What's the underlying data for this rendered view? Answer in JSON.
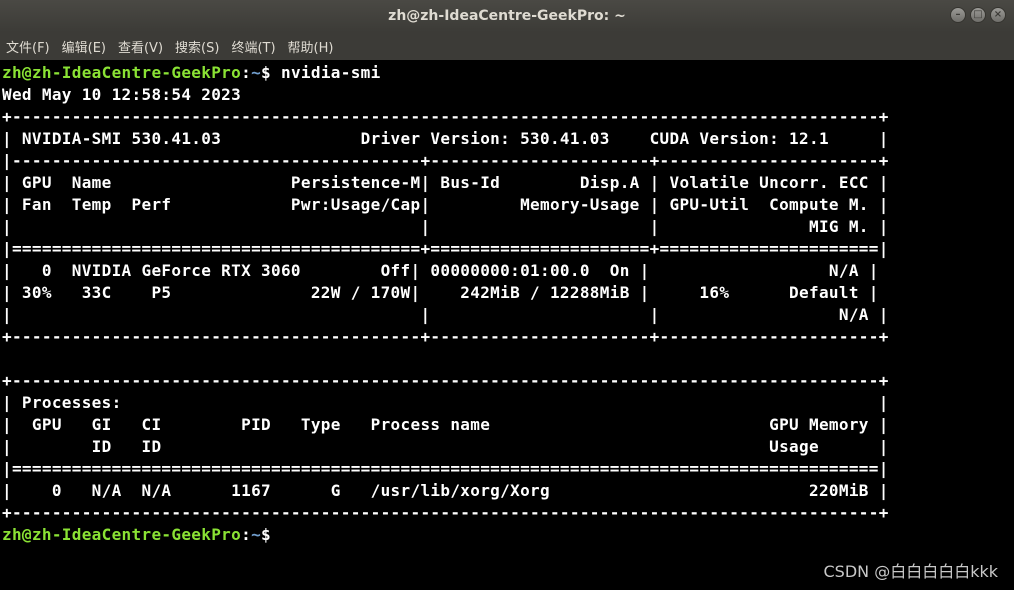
{
  "window": {
    "title": "zh@zh-IdeaCentre-GeekPro: ~",
    "controls": {
      "minimize": "–",
      "maximize": "□",
      "close": "×"
    }
  },
  "menu": {
    "items": [
      "文件(F)",
      "编辑(E)",
      "查看(V)",
      "搜索(S)",
      "终端(T)",
      "帮助(H)"
    ]
  },
  "terminal": {
    "prompt_user": "zh@zh-IdeaCentre-GeekPro",
    "prompt_path": "~",
    "prompt_sep": ":",
    "prompt_symbol": "$",
    "command": " nvidia-smi",
    "output_lines": [
      "Wed May 10 12:58:54 2023",
      "+---------------------------------------------------------------------------------------+",
      "| NVIDIA-SMI 530.41.03              Driver Version: 530.41.03    CUDA Version: 12.1     |",
      "|-----------------------------------------+----------------------+----------------------+",
      "| GPU  Name                  Persistence-M| Bus-Id        Disp.A | Volatile Uncorr. ECC |",
      "| Fan  Temp  Perf            Pwr:Usage/Cap|         Memory-Usage | GPU-Util  Compute M. |",
      "|                                         |                      |               MIG M. |",
      "|=========================================+======================+======================|",
      "|   0  NVIDIA GeForce RTX 3060        Off| 00000000:01:00.0  On |                  N/A |",
      "| 30%   33C    P5              22W / 170W|    242MiB / 12288MiB |     16%      Default |",
      "|                                         |                      |                  N/A |",
      "+-----------------------------------------+----------------------+----------------------+",
      "",
      "+---------------------------------------------------------------------------------------+",
      "| Processes:                                                                            |",
      "|  GPU   GI   CI        PID   Type   Process name                            GPU Memory |",
      "|        ID   ID                                                             Usage      |",
      "|=======================================================================================|",
      "|    0   N/A  N/A      1167      G   /usr/lib/xorg/Xorg                          220MiB |",
      "+---------------------------------------------------------------------------------------+"
    ]
  },
  "watermark": "CSDN @白白白白白kkk",
  "colors": {
    "prompt_user": "#8ae234",
    "prompt_path": "#729fcf",
    "terminal_bg": "#000000",
    "terminal_fg": "#ffffff",
    "titlebar_bg": "#3c3b37"
  }
}
